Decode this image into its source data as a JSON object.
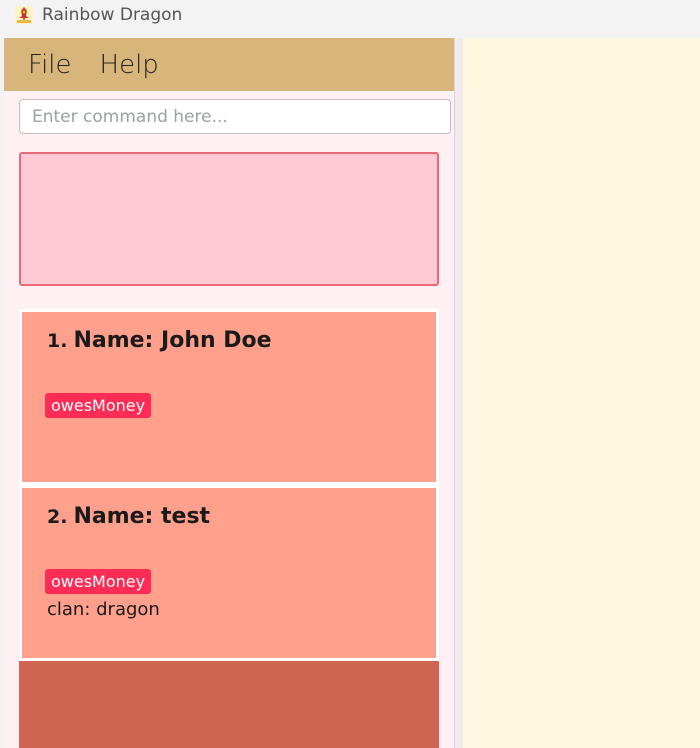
{
  "window": {
    "title": "Rainbow Dragon",
    "icon": "dragon-icon"
  },
  "menu": {
    "items": [
      {
        "label": "File"
      },
      {
        "label": "Help"
      }
    ]
  },
  "command": {
    "value": "",
    "placeholder": "Enter command here..."
  },
  "result": {
    "text": ""
  },
  "persons": [
    {
      "index": "1.",
      "name": "Name: John Doe",
      "tags": [
        "owesMoney"
      ],
      "clan": ""
    },
    {
      "index": "2.",
      "name": "Name: test",
      "tags": [
        "owesMoney"
      ],
      "clan": "clan: dragon"
    }
  ],
  "colors": {
    "menubar": "#d8b57a",
    "result_bg": "#ffcad4",
    "result_border": "#e86a7a",
    "card_bg": "#ffa08c",
    "selected_card_bg": "#cf6550",
    "tag_bg": "#ff2d55",
    "right_pane": "#fff8e1"
  }
}
